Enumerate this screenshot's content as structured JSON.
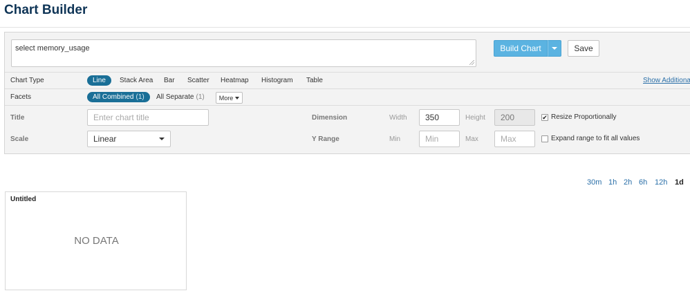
{
  "page": {
    "title": "Chart Builder"
  },
  "query": {
    "text": "select memory_usage"
  },
  "actions": {
    "build_label": "Build Chart",
    "save_label": "Save"
  },
  "chart_type": {
    "label": "Chart Type",
    "options": [
      "Line",
      "Stack Area",
      "Bar",
      "Scatter",
      "Heatmap",
      "Histogram",
      "Table"
    ],
    "selected": "Line",
    "show_additional": "Show Additiona"
  },
  "facets": {
    "label": "Facets",
    "combined_label": "All Combined",
    "combined_count": "(1)",
    "separate_label": "All Separate",
    "separate_count": "(1)",
    "more_label": "More"
  },
  "settings": {
    "title_label": "Title",
    "title_placeholder": "Enter chart title",
    "dimension_label": "Dimension",
    "width_label": "Width",
    "width_value": "350",
    "height_label": "Height",
    "height_value": "200",
    "resize_label": "Resize Proportionally",
    "resize_checked": true,
    "scale_label": "Scale",
    "scale_value": "Linear",
    "yrange_label": "Y Range",
    "min_label": "Min",
    "min_placeholder": "Min",
    "max_label": "Max",
    "max_placeholder": "Max",
    "expand_label": "Expand range to fit all values",
    "expand_checked": false
  },
  "time_ranges": {
    "options": [
      "30m",
      "1h",
      "2h",
      "6h",
      "12h",
      "1d"
    ],
    "selected": "1d"
  },
  "chart": {
    "title": "Untitled",
    "empty_text": "NO DATA"
  },
  "icons": {
    "check": "check-icon",
    "caret": "chevron-down-icon",
    "grip": "resize-grip-icon"
  },
  "colors": {
    "accent": "#5bb3e1",
    "active_pill": "#1a6f97",
    "title": "#0e3456",
    "link": "#2a6fa8"
  }
}
